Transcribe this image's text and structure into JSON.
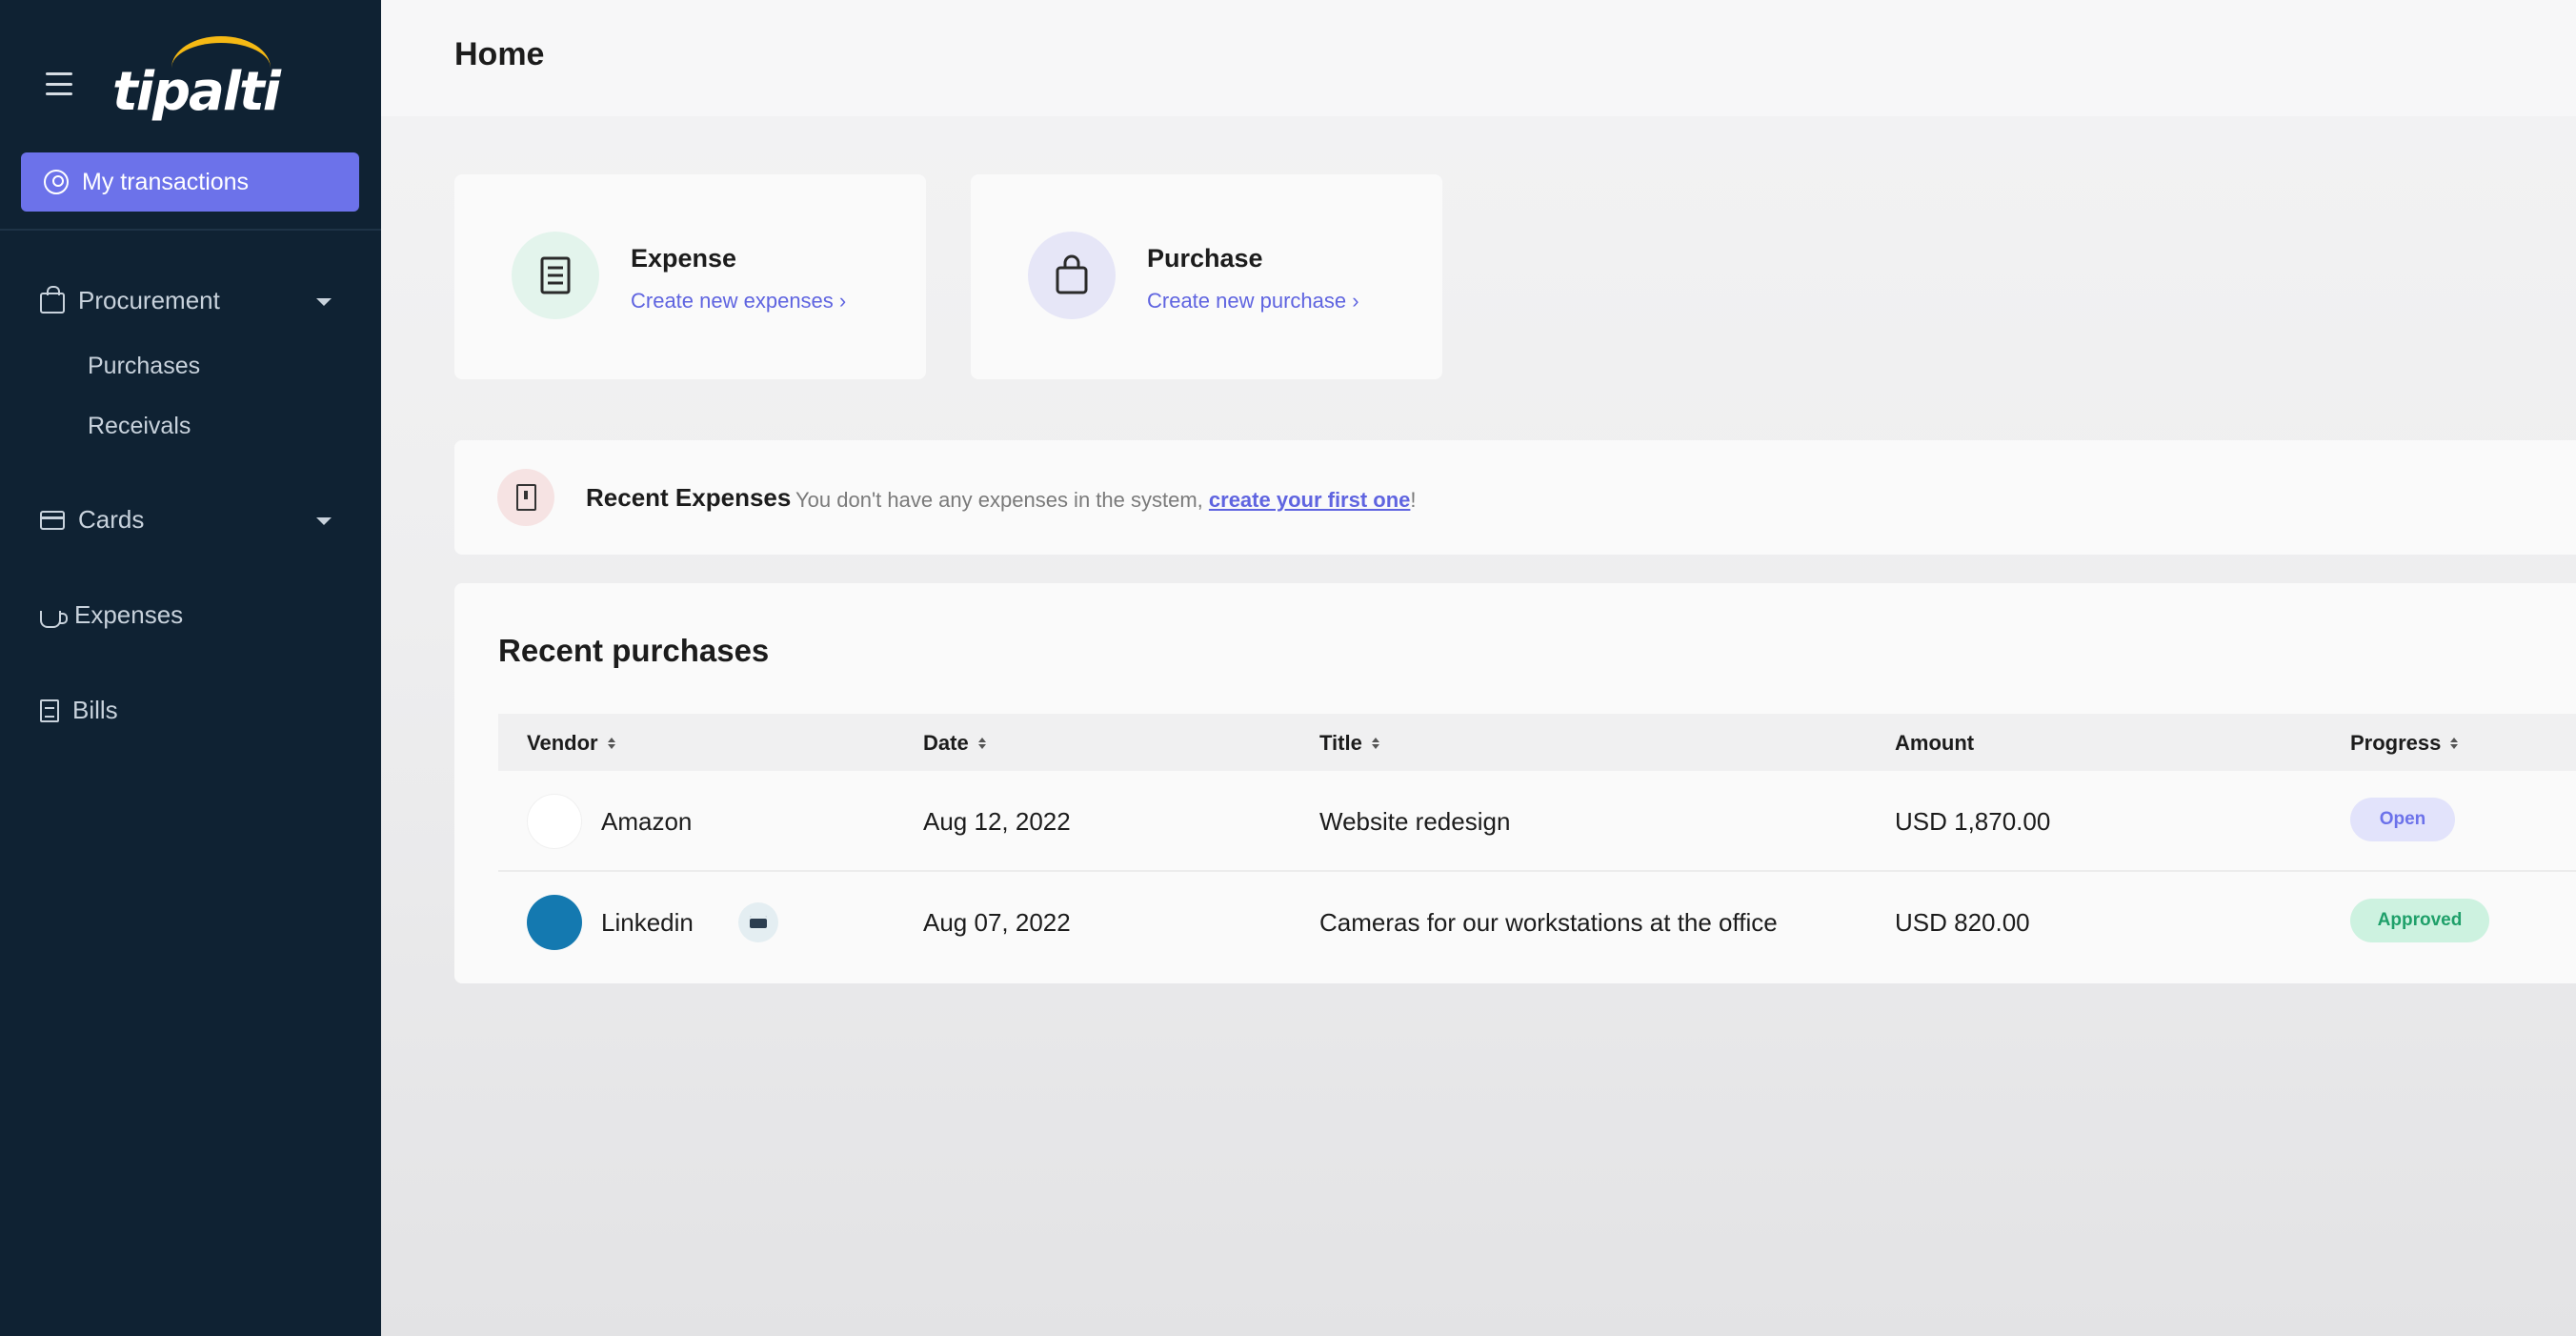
{
  "sidebar": {
    "logo_text": "tipalti",
    "my_transactions": "My transactions",
    "procurement": "Procurement",
    "purchases": "Purchases",
    "receivals": "Receivals",
    "cards": "Cards",
    "expenses": "Expenses",
    "bills": "Bills"
  },
  "header": {
    "title": "Home"
  },
  "cards": {
    "expense": {
      "title": "Expense",
      "link": "Create new expenses ›"
    },
    "purchase": {
      "title": "Purchase",
      "link": "Create new purchase ›"
    }
  },
  "recent_expenses": {
    "title": "Recent Expenses",
    "message": "You don't have any expenses in the system, ",
    "link": "create your first one",
    "suffix": "!"
  },
  "recent_purchases": {
    "title": "Recent purchases",
    "columns": {
      "vendor": "Vendor",
      "date": "Date",
      "title": "Title",
      "amount": "Amount",
      "progress": "Progress"
    },
    "rows": [
      {
        "vendor": "Amazon",
        "date": "Aug 12, 2022",
        "title": "Website redesign",
        "amount": "USD 1,870.00",
        "progress": "Open"
      },
      {
        "vendor": "Linkedin",
        "date": "Aug 07, 2022",
        "title": "Cameras for our workstations at the office",
        "amount": "USD 820.00",
        "progress": "Approved"
      }
    ]
  },
  "colors": {
    "accent": "#6c72ea",
    "sidebar_bg": "#0f2233",
    "logo_arc": "#f5b914",
    "approved": "#1fa06a"
  },
  "icons": [
    "hamburger-icon",
    "user-circle-icon",
    "shopping-bag-icon",
    "credit-card-icon",
    "cup-icon",
    "bill-icon",
    "receipt-icon",
    "sort-icon",
    "chevron-down-icon"
  ]
}
